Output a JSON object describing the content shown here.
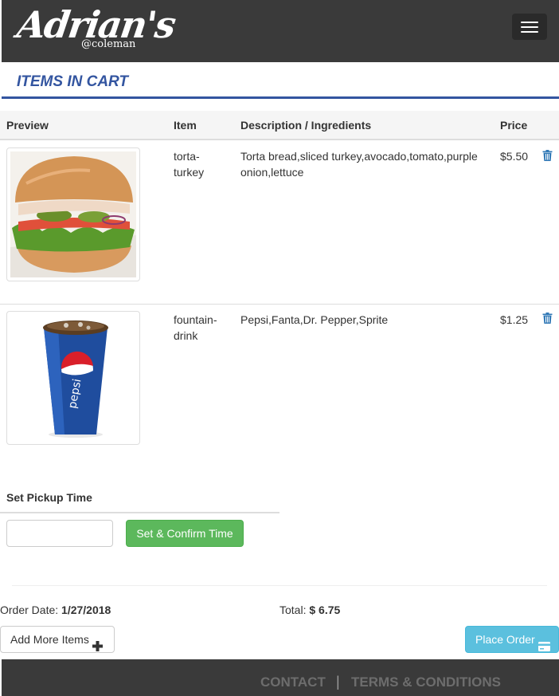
{
  "header": {
    "logo_text": "Adrian's",
    "logo_subtext": "@coleman",
    "menu_icon": "hamburger-menu-icon"
  },
  "page": {
    "title": "ITEMS IN CART",
    "accent_color": "#3355a0"
  },
  "table": {
    "headers": [
      "Preview",
      "Item",
      "Description / Ingredients",
      "Price"
    ],
    "rows": [
      {
        "preview_icon": "torta-sandwich-image",
        "item": "torta-turkey",
        "description": "Torta bread,sliced turkey,avocado,tomato,purple onion,lettuce",
        "price": "$5.50",
        "delete_icon": "trash-icon"
      },
      {
        "preview_icon": "pepsi-cup-image",
        "item": "fountain-drink",
        "description": "Pepsi,Fanta,Dr. Pepper,Sprite",
        "price": "$1.25",
        "delete_icon": "trash-icon"
      }
    ]
  },
  "pickup": {
    "label": "Set Pickup Time",
    "input_value": "",
    "confirm_label": "Set & Confirm Time",
    "confirm_color": "#5cb85c"
  },
  "summary": {
    "order_date_label": "Order Date: ",
    "order_date": "1/27/2018",
    "total_label": "Total: ",
    "total": "$ 6.75"
  },
  "actions": {
    "add_more_label": "Add More Items",
    "add_more_icon": "plus-icon",
    "place_order_label": "Place Order",
    "place_order_icon": "credit-card-icon",
    "place_order_color": "#5bc0de"
  },
  "footer": {
    "links": [
      "CONTACT",
      "TERMS & CONDITIONS"
    ],
    "separator": "|"
  }
}
